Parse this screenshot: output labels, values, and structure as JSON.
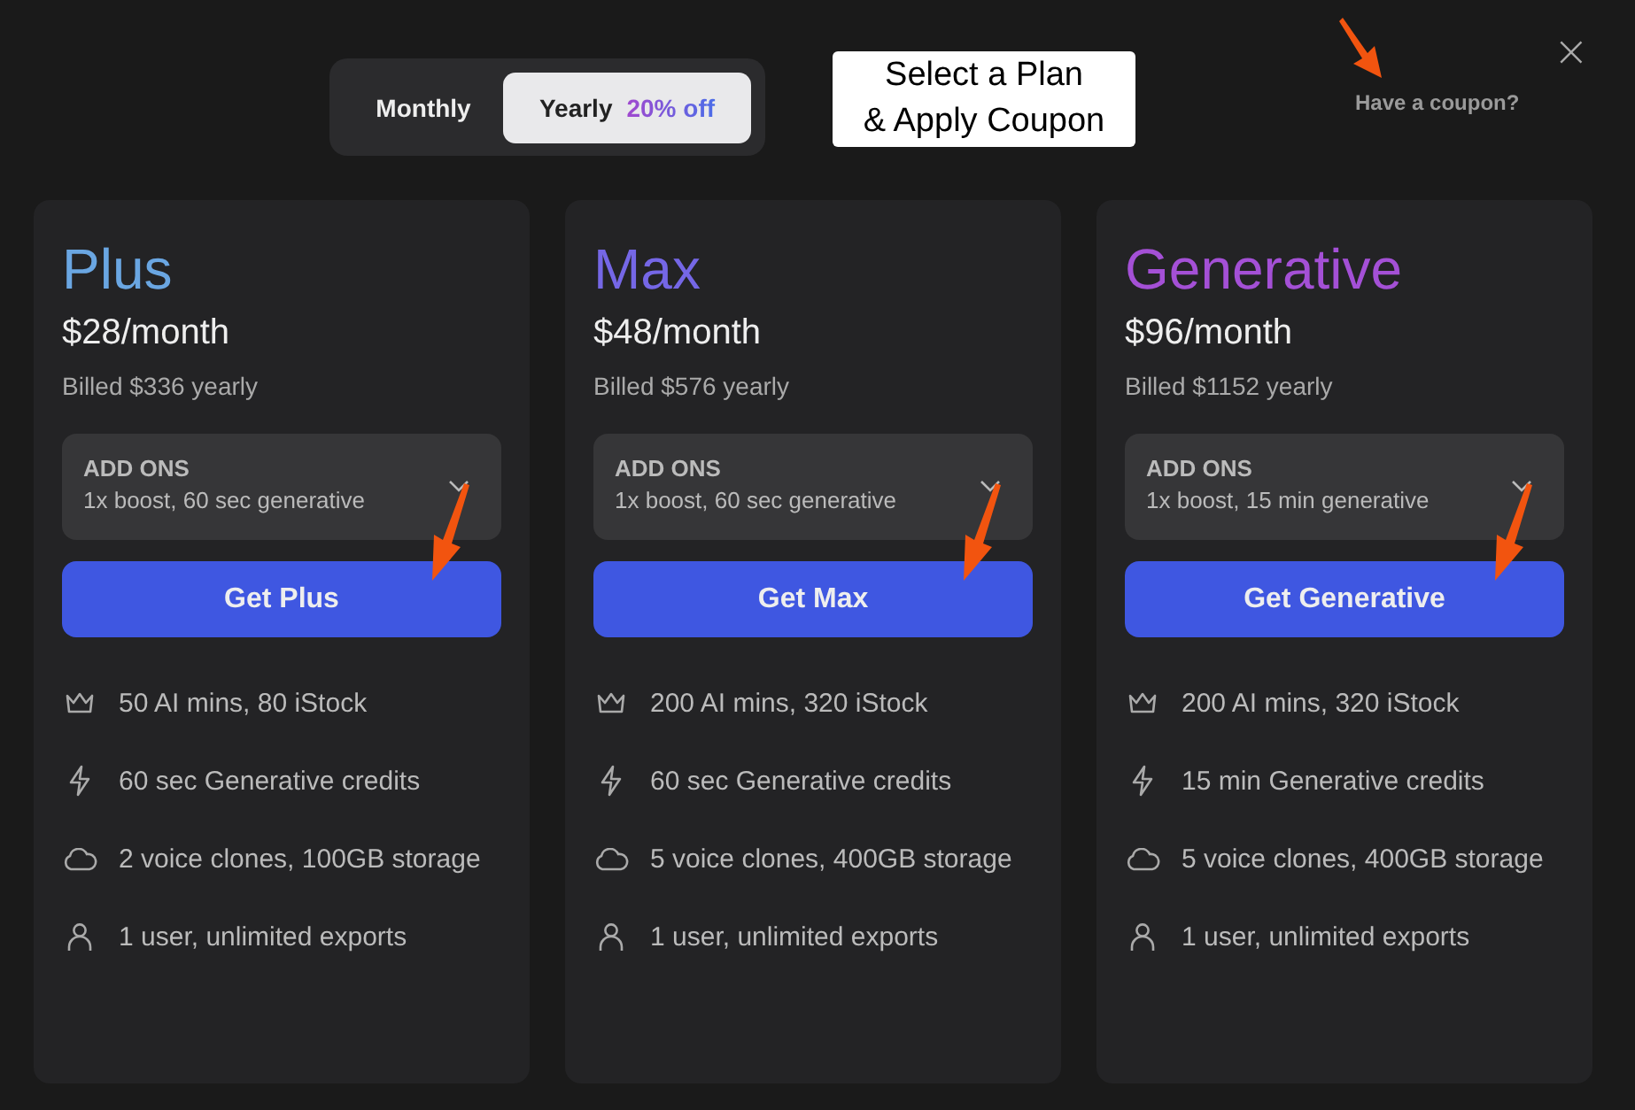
{
  "billing_toggle": [
    {
      "label": "Monthly",
      "selected": false
    },
    {
      "label": "Yearly",
      "badge": "20% off",
      "selected": true
    }
  ],
  "callout": {
    "lines": [
      "Select a Plan",
      "& Apply Coupon"
    ]
  },
  "coupon_link": "Have a coupon?",
  "close": "×",
  "plans": [
    {
      "name": "Plus",
      "color": "#6aa6e2",
      "price": "$28/month",
      "billed": "Billed $336 yearly",
      "addons_label": "ADD ONS",
      "addons_value": "1x boost, 60 sec generative",
      "button": "Get Plus",
      "features": [
        {
          "kind": "crown",
          "text": "50 AI mins, 80 iStock"
        },
        {
          "kind": "bolt",
          "text": "60 sec Generative credits"
        },
        {
          "kind": "cloud",
          "text": "2 voice clones, 100GB storage"
        },
        {
          "kind": "user",
          "text": "1 user, unlimited exports"
        }
      ]
    },
    {
      "name": "Max",
      "color": "#7567e6",
      "price": "$48/month",
      "billed": "Billed $576 yearly",
      "addons_label": "ADD ONS",
      "addons_value": "1x boost, 60 sec generative",
      "button": "Get Max",
      "features": [
        {
          "kind": "crown",
          "text": "200 AI mins, 320 iStock"
        },
        {
          "kind": "bolt",
          "text": "60 sec Generative credits"
        },
        {
          "kind": "cloud",
          "text": "5 voice clones, 400GB storage"
        },
        {
          "kind": "user",
          "text": "1 user, unlimited exports"
        }
      ]
    },
    {
      "name": "Generative",
      "color": "#a450d6",
      "price": "$96/month",
      "billed": "Billed $1152 yearly",
      "addons_label": "ADD ONS",
      "addons_value": "1x boost, 15 min generative",
      "button": "Get Generative",
      "features": [
        {
          "kind": "crown",
          "text": "200 AI mins, 320 iStock"
        },
        {
          "kind": "bolt",
          "text": "15 min Generative credits"
        },
        {
          "kind": "cloud",
          "text": "5 voice clones, 400GB storage"
        },
        {
          "kind": "user",
          "text": "1 user, unlimited exports"
        }
      ]
    }
  ]
}
